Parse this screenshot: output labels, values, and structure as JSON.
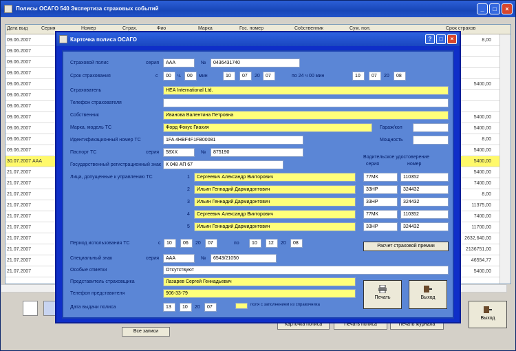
{
  "window": {
    "title": "Полисы ОСАГО 540 Экспертиза страховых событий",
    "dialog_title": "Карточка полиса ОСАГО"
  },
  "grid": {
    "headers": [
      "Дата выд",
      "Серия",
      "Номер",
      "Страх.",
      "Фио",
      "Марка",
      "Гос. номер",
      "Собственник",
      "Сум. пол.",
      "Срок страхов"
    ],
    "rows": [
      {
        "date": "09.06.2007",
        "amount": "8,00"
      },
      {
        "date": "09.06.2007",
        "amount": ""
      },
      {
        "date": "09.06.2007",
        "amount": ""
      },
      {
        "date": "09.06.2007",
        "amount": ""
      },
      {
        "date": "09.06.2007",
        "amount": "5400,00"
      },
      {
        "date": "09.06.2007",
        "amount": ""
      },
      {
        "date": "09.06.2007",
        "amount": ""
      },
      {
        "date": "09.06.2007",
        "amount": "5400,00"
      },
      {
        "date": "09.06.2007",
        "amount": "5400,00"
      },
      {
        "date": "09.06.2007",
        "amount": "8,00"
      },
      {
        "date": "09.06.2007",
        "amount": "5400,00"
      },
      {
        "date": "30.07.2007 ААА",
        "amount": "5400,00",
        "selected": true
      },
      {
        "date": "21.07.2007",
        "amount": "5400,00"
      },
      {
        "date": "21.07.2007",
        "amount": "7400,00"
      },
      {
        "date": "21.07.2007",
        "amount": "8,00"
      },
      {
        "date": "21.07.2007",
        "amount": "11375,00"
      },
      {
        "date": "21.07.2007",
        "amount": "7400,00"
      },
      {
        "date": "21.07.2007",
        "amount": "11700,00"
      },
      {
        "date": "21.07.2007",
        "amount": "2632,640,00"
      },
      {
        "date": "21.07.2007",
        "amount": "2136751,00"
      },
      {
        "date": "21.07.2007",
        "amount": "46554,77"
      },
      {
        "date": "21.07.2007",
        "amount": "5400,00"
      }
    ]
  },
  "bottom": {
    "all_payments": "Все записи",
    "btn_card": "Карточка полиса",
    "btn_print": "Печать полиса",
    "btn_journal": "Печать журнала",
    "btn_exit": "Выход"
  },
  "form": {
    "policy_label": "Страховой полис",
    "series_label": "серия",
    "series": "ААА",
    "number_sign": "№",
    "number": "0436431740",
    "period_label": "Срок страхования",
    "from_prefix": "с",
    "from_h": "00",
    "h_suffix": "ч.",
    "from_m": "00",
    "m_suffix": "мин",
    "from_d": "10",
    "from_mo": "07",
    "y20": "20",
    "from_y": "07",
    "to_prefix": "по 24 ч 00 мин",
    "to_d": "10",
    "to_mo": "07",
    "to_y": "08",
    "insurer_label": "Страхователь",
    "insurer": "НЕА International Ltd.",
    "insurer_phone_label": "Телефон страхователя",
    "insurer_phone": "",
    "owner_label": "Собственник",
    "owner": "Иванова Валентина Петровна",
    "brand_label": "Марка, модель ТС",
    "brand": "Форд Фокус Гиахия",
    "tow_label": "Гараж/кол",
    "tow": "",
    "power_label": "Мощность",
    "power": "",
    "vin_label": "Идентификационный номер ТС",
    "vin": "1FA 4HBF4F1FB00081",
    "pts_label": "Паспорт ТС",
    "pts_series_label": "серия",
    "pts_series": "58ХХ",
    "pts_number": "875190",
    "reg_label": "Государственный регистрационный знак",
    "reg": "К 048 АП 67",
    "drivers_label": "Лица, допущенные к управлению ТС",
    "drivers_lic_head": "Водительское удостоверение",
    "drivers_lic_series_head": "серия",
    "drivers_lic_number_head": "номер",
    "drivers": [
      {
        "n": "1",
        "name": "Сергеевич Александр Викторович",
        "series": "77МК",
        "number": "110352"
      },
      {
        "n": "2",
        "name": "Ильин Геннадий Дармидонтович",
        "series": "33НР",
        "number": "324432"
      },
      {
        "n": "3",
        "name": "Ильин Геннадий Дармидонтович",
        "series": "33НР",
        "number": "324432"
      },
      {
        "n": "4",
        "name": "Сергеевич Александр Викторович",
        "series": "77МК",
        "number": "110352"
      },
      {
        "n": "5",
        "name": "Ильин Геннадий Дармидонтович",
        "series": "33НР",
        "number": "324432"
      }
    ],
    "use_period_label": "Период использования ТС",
    "use_from_prefix": "с",
    "use_from_d": "10",
    "use_from_mo": "06",
    "use_from_y": "07",
    "use_to_prefix": "по",
    "use_to_d": "10",
    "use_to_mo": "12",
    "use_to_y": "08",
    "calc_btn": "Расчет страховой премии",
    "special_label": "Специальный знак",
    "special_series_label": "серия",
    "special_series": "ААА",
    "special_number": "6543/21050",
    "special_marks_label": "Особые отметки",
    "special_marks": "Отсутствуют",
    "agent_label": "Представитель страховщика",
    "agent": "Лазарев Сергей Геннадьевич",
    "agent_phone_label": "Телефон представителя",
    "agent_phone": "906-33-79",
    "issue_label": "Дата выдачи полиса",
    "issue_d": "13",
    "issue_mo": "10",
    "issue_y": "07",
    "legend": "поля с заполнением из справочника",
    "print_btn": "Печать",
    "exit_btn": "Выход",
    "legend_color": "#ffff7a"
  }
}
